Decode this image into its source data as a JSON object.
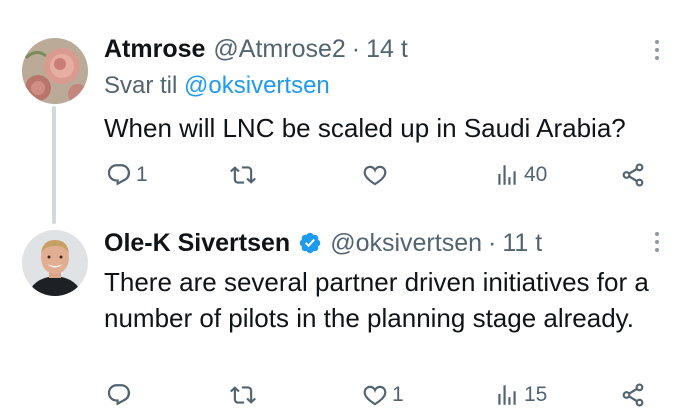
{
  "tweets": [
    {
      "name": "Atmrose",
      "handle": "@Atmrose2",
      "separator": "·",
      "time": "14 t",
      "reply_prefix": "Svar til",
      "reply_mention": "@oksivertsen",
      "text": "When will LNC be scaled up in Saudi Arabia?",
      "verified": false,
      "replies": "1",
      "retweets": "",
      "likes": "",
      "views": "40",
      "avatar": "rose-flowers-avatar"
    },
    {
      "name": "Ole-K Sivertsen",
      "handle": "@oksivertsen",
      "separator": "·",
      "time": "11 t",
      "text": "There are several partner driven initiatives for a number of pilots in the planning stage already.",
      "verified": true,
      "replies": "",
      "retweets": "",
      "likes": "1",
      "views": "15",
      "avatar": "man-portrait-avatar"
    }
  ],
  "colors": {
    "text": "#0f1419",
    "secondary": "#536471",
    "link": "#1d9bf0",
    "verified": "#1d9bf0",
    "thread_line": "#cfd9de"
  },
  "icons": {
    "reply": "speech-bubble-icon",
    "retweet": "retweet-arrows-icon",
    "like": "heart-icon",
    "views": "bar-chart-icon",
    "share": "share-icon",
    "more": "vertical-ellipsis-icon",
    "verified": "verified-badge-icon"
  }
}
